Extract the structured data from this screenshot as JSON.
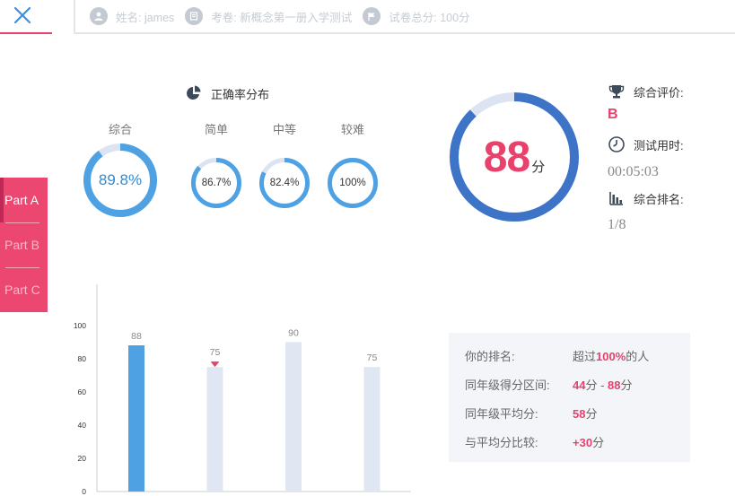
{
  "header": {
    "name_label": "姓名: james",
    "exam_label": "考卷: 新概念第一册入学测试",
    "total_label": "试卷总分: 100分"
  },
  "tabs": [
    {
      "label": "Part A",
      "active": true
    },
    {
      "label": "Part B",
      "active": false
    },
    {
      "label": "Part C",
      "active": false
    }
  ],
  "accuracy": {
    "title": "正确率分布",
    "gauges": [
      {
        "label": "综合",
        "value": "89.8%",
        "fraction": 0.898
      },
      {
        "label": "简单",
        "value": "86.7%",
        "fraction": 0.867
      },
      {
        "label": "中等",
        "value": "82.4%",
        "fraction": 0.824
      },
      {
        "label": "较难",
        "value": "100%",
        "fraction": 1.0
      }
    ]
  },
  "score": {
    "value": "88",
    "unit": "分",
    "fraction": 0.88
  },
  "summary": {
    "rating_label": "综合评价:",
    "rating_value": "B",
    "time_label": "测试用时:",
    "time_value": "00:05:03",
    "rank_label": "综合排名:",
    "rank_value": "1/8"
  },
  "stats": {
    "rank_label": "你的排名:",
    "rank_prefix": "超过",
    "rank_highlight": "100%",
    "rank_suffix": "的人",
    "range_label": "同年级得分区间:",
    "range_low": "44",
    "range_high": "88",
    "range_unit": "分",
    "range_sep": " - ",
    "avg_label": "同年级平均分:",
    "avg_value": "58",
    "avg_unit": "分",
    "diff_label": "与平均分比较:",
    "diff_value": "+30",
    "diff_unit": "分"
  },
  "colors": {
    "accent": "#e8416c",
    "gauge_fill": "#4ea1e3",
    "gauge_track": "#dce4f2",
    "big_ring": "#3d74c8",
    "bar_primary": "#4ea1e3",
    "bar_secondary": "#e1e7f2"
  },
  "chart_data": {
    "type": "bar",
    "categories": [
      "",
      "",
      "",
      ""
    ],
    "values": [
      88,
      75,
      90,
      75
    ],
    "data_labels": [
      "88",
      "75",
      "90",
      "75"
    ],
    "yticks": [
      0,
      20,
      40,
      60,
      80,
      100
    ],
    "ylim": [
      0,
      115
    ],
    "highlight_index": 0,
    "marker_index": 1
  }
}
